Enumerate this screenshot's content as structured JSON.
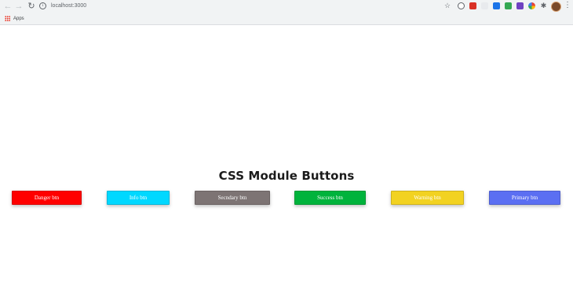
{
  "browser": {
    "url": "localhost:3000",
    "bookmarks_bar": {
      "apps_label": "Apps"
    }
  },
  "page": {
    "heading": "CSS Module Buttons",
    "buttons": [
      {
        "label": "Danger btn",
        "color": "#ff0000"
      },
      {
        "label": "Info btn",
        "color": "#00d8ff"
      },
      {
        "label": "Secndary btn",
        "color": "#7d7474"
      },
      {
        "label": "Success btn",
        "color": "#00b33c"
      },
      {
        "label": "Warning btn",
        "color": "#f2d221"
      },
      {
        "label": "Primary btn",
        "color": "#5b6ff2"
      }
    ]
  }
}
